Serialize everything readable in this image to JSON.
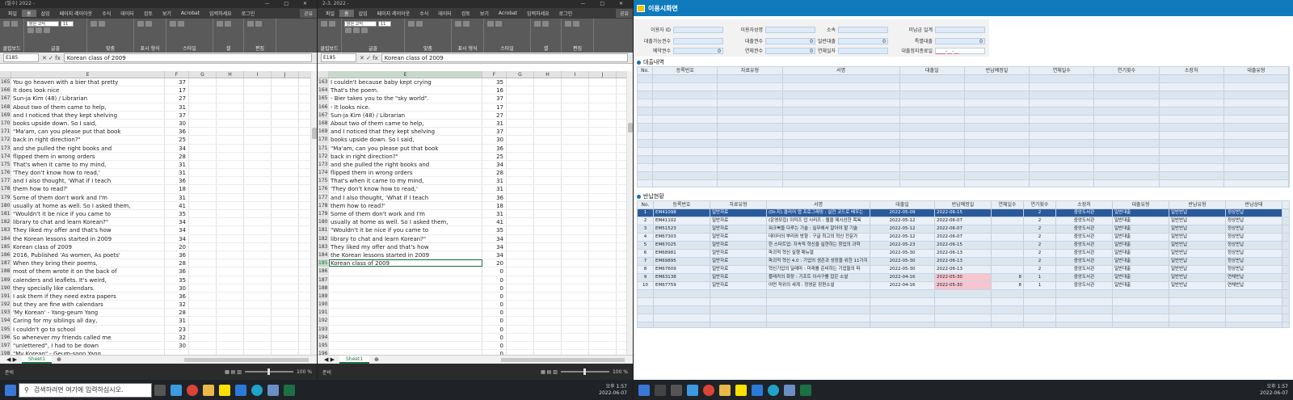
{
  "excel_left": {
    "title": "(필수) 2022 -",
    "ribbon_tabs": [
      "파일",
      "홈",
      "삽입",
      "페이지 레이아웃",
      "수식",
      "데이터",
      "검토",
      "보기",
      "Acrobat",
      "입력하세요",
      "로그인",
      "공유"
    ],
    "ribbon_groups": [
      "클립보드",
      "글꼴",
      "맞춤",
      "표시 형식",
      "스타일",
      "셀",
      "편집"
    ],
    "font_name": "맑은 고딕",
    "font_size": "11",
    "name_box": "E185",
    "formula": "Korean class of 2009",
    "columns": [
      "E",
      "F",
      "G",
      "H",
      "I",
      "J"
    ],
    "rows": [
      {
        "n": "165",
        "e": "You go heaven with a bier that pretty",
        "f": "37"
      },
      {
        "n": "166",
        "e": "It does look nice",
        "f": "17"
      },
      {
        "n": "167",
        "e": "Sun-ja Kim (48) / Librarian",
        "f": "27"
      },
      {
        "n": "168",
        "e": "About two of them came to help,",
        "f": "31"
      },
      {
        "n": "169",
        "e": "and I noticed that they kept shelving",
        "f": "37"
      },
      {
        "n": "170",
        "e": "books upside down.  So I said,",
        "f": "30"
      },
      {
        "n": "171",
        "e": "\"Ma'am, can you please put that book",
        "f": "36"
      },
      {
        "n": "172",
        "e": "back in right direction?\"",
        "f": "25"
      },
      {
        "n": "173",
        "e": "and she pulled the right books and",
        "f": "34"
      },
      {
        "n": "174",
        "e": "flipped them in wrong orders",
        "f": "28"
      },
      {
        "n": "175",
        "e": "That's when it came to my mind,",
        "f": "31"
      },
      {
        "n": "176",
        "e": "'They don't know how to read,'",
        "f": "31"
      },
      {
        "n": "177",
        "e": "and I also thought, 'What if I teach",
        "f": "36"
      },
      {
        "n": "178",
        "e": "them how to read?'",
        "f": "18"
      },
      {
        "n": "179",
        "e": "Some of them don't work and I'm",
        "f": "31"
      },
      {
        "n": "180",
        "e": "usually at home as well. So I asked them,",
        "f": "41"
      },
      {
        "n": "181",
        "e": "\"Wouldn't it be nice if you came to",
        "f": "35"
      },
      {
        "n": "182",
        "e": "library to chat and learn Korean?\"",
        "f": "34"
      },
      {
        "n": "183",
        "e": "They liked my offer and that's how",
        "f": "34"
      },
      {
        "n": "184",
        "e": "the Korean lessons started in 2009",
        "f": "34"
      },
      {
        "n": "185",
        "e": "Korean class of 2009",
        "f": "20"
      },
      {
        "n": "186",
        "e": "2016, Published 'As women, As poets'",
        "f": "36"
      },
      {
        "n": "187",
        "e": "When they bring their poems,",
        "f": "28"
      },
      {
        "n": "188",
        "e": "most of them wrote it on the back of",
        "f": "36"
      },
      {
        "n": "189",
        "e": "calenders and leaflets. It's weird,",
        "f": "35"
      },
      {
        "n": "190",
        "e": "they specially like calendars.",
        "f": "30"
      },
      {
        "n": "191",
        "e": "I ask them if they need extra papers",
        "f": "36"
      },
      {
        "n": "192",
        "e": "but they are fine with calendars",
        "f": "32"
      },
      {
        "n": "193",
        "e": "'My Korean' - Yang-geum Yang",
        "f": "28"
      },
      {
        "n": "194",
        "e": "Caring for my siblings all day,",
        "f": "31"
      },
      {
        "n": "195",
        "e": "I couldn't go to school",
        "f": "23"
      },
      {
        "n": "196",
        "e": "So whenever my friends called me",
        "f": "32"
      },
      {
        "n": "197",
        "e": "\"unlettered\", I had to be down",
        "f": "30"
      },
      {
        "n": "198",
        "e": "\"My Korean\" - Geum-soon Yang",
        "f": ""
      }
    ],
    "sheet_tab": "Sheet1",
    "status_left": "준비",
    "zoom": "100 %"
  },
  "excel_mid": {
    "title": "2-3. 2022 -",
    "name_box": "E185",
    "formula": "Korean class of 2009",
    "columns": [
      "E",
      "F",
      "G",
      "H",
      "I",
      "J"
    ],
    "rows": [
      {
        "n": "163",
        "e": "I couldn't because baby kept crying",
        "f": "35"
      },
      {
        "n": "164",
        "e": "That's the poem.",
        "f": "16"
      },
      {
        "n": "165",
        "e": "- Bier takes you to the \"sky world\".",
        "f": "37"
      },
      {
        "n": "166",
        "e": "- It looks nice.",
        "f": "17"
      },
      {
        "n": "167",
        "e": "Sun-ja Kim (48) / Librarian",
        "f": "27"
      },
      {
        "n": "168",
        "e": "About two of them came to help,",
        "f": "31"
      },
      {
        "n": "169",
        "e": "and I noticed that they kept shelving",
        "f": "37"
      },
      {
        "n": "170",
        "e": "books upside down.  So I said,",
        "f": "30"
      },
      {
        "n": "171",
        "e": "\"Ma'am, can you please put that book",
        "f": "36"
      },
      {
        "n": "172",
        "e": "back in right direction?\"",
        "f": "25"
      },
      {
        "n": "173",
        "e": "and she pulled the right books and",
        "f": "34"
      },
      {
        "n": "174",
        "e": "flipped them in wrong orders",
        "f": "28"
      },
      {
        "n": "175",
        "e": "That's when it came to my mind,",
        "f": "31"
      },
      {
        "n": "176",
        "e": "'They don't know how to read,'",
        "f": "31"
      },
      {
        "n": "177",
        "e": "and I also thought, 'What if I teach",
        "f": "36"
      },
      {
        "n": "178",
        "e": "them how to read?'",
        "f": "18"
      },
      {
        "n": "179",
        "e": "Some of them don't work and I'm",
        "f": "31"
      },
      {
        "n": "180",
        "e": "usually at home as well. So I asked them,",
        "f": "41"
      },
      {
        "n": "181",
        "e": "\"Wouldn't it be nice if you came to",
        "f": "35"
      },
      {
        "n": "182",
        "e": "library to chat and learn Korean?\"",
        "f": "34"
      },
      {
        "n": "183",
        "e": "They liked my offer and that's how",
        "f": "34"
      },
      {
        "n": "184",
        "e": "the Korean lessons started in 2009",
        "f": "34"
      },
      {
        "n": "185",
        "e": "Korean class of 2009",
        "f": "20"
      },
      {
        "n": "186",
        "e": "",
        "f": "0"
      },
      {
        "n": "187",
        "e": "",
        "f": "0"
      },
      {
        "n": "188",
        "e": "",
        "f": "0"
      },
      {
        "n": "189",
        "e": "",
        "f": "0"
      },
      {
        "n": "190",
        "e": "",
        "f": "0"
      },
      {
        "n": "191",
        "e": "",
        "f": "0"
      },
      {
        "n": "192",
        "e": "",
        "f": "0"
      },
      {
        "n": "193",
        "e": "",
        "f": "0"
      },
      {
        "n": "194",
        "e": "",
        "f": "0"
      },
      {
        "n": "195",
        "e": "",
        "f": "0"
      },
      {
        "n": "196",
        "e": "",
        "f": "0"
      },
      {
        "n": "197",
        "e": "",
        "f": "0"
      },
      {
        "n": "198",
        "e": "",
        "f": "0"
      }
    ],
    "sheet_tab": "Sheet1",
    "status_left": "준비",
    "zoom": "100 %"
  },
  "erp": {
    "title": "이용시화면",
    "form": {
      "f1_label": "이용자 ID",
      "f1_value": "",
      "f2_label": "이용자성명",
      "f2_value": "",
      "f3_label": "소속",
      "f3_value": "",
      "f4_label": "미납금 일계",
      "f4_value": "",
      "f5_label": "대출가능권수",
      "f5_value": "",
      "f6_label": "대출권수",
      "f6_value": "0",
      "f7_label": "일반대출",
      "f7_value": "0",
      "f8_label": "특별대출",
      "f8_value": "0",
      "f9_label": "예약권수",
      "f9_value": "0",
      "f10_label": "연체권수",
      "f10_value": "0",
      "f11_label": "연체일자",
      "f11_value": "",
      "f12_label": "대출정지종료일",
      "f12_value": "____-__-__"
    },
    "sec1": "대출내역",
    "t1_headers": [
      "No.",
      "등록번호",
      "자료유형",
      "서명",
      "대출일",
      "반납예정일",
      "연체일수",
      "연기횟수",
      "소장처",
      "대출유형"
    ],
    "sec2": "반납현황",
    "t2_headers": [
      "No.",
      "등록번호",
      "자료유형",
      "서명",
      "대출일",
      "반납예정일",
      "연체일수",
      "연기횟수",
      "소장처",
      "대출유형",
      "반납유형",
      "반납상태"
    ],
    "t2_rows": [
      {
        "no": "1",
        "reg": "EM41098",
        "type": "일반자료",
        "title": "(Dr.지) 클리어 앱 프로그래밍 : 실전 코드로 배우는",
        "loan": "2022-05-09",
        "due": "2022-06-15",
        "over": "",
        "ext": "2",
        "loc": "중앙도서관",
        "ltype": "일반대출",
        "rtype": "일반반납",
        "rstat": "정상반납"
      },
      {
        "no": "2",
        "reg": "EM41102",
        "type": "일반자료",
        "title": "(운영모집) 이미즈 업 시리즈 : 웹을 제시선한 목욕",
        "loan": "2022-05-12",
        "due": "2022-06-07",
        "over": "",
        "ext": "2",
        "loc": "중앙도서관",
        "ltype": "일반대출",
        "rtype": "일반반납",
        "rstat": "정상반납"
      },
      {
        "no": "3",
        "reg": "EM51523",
        "type": "일반자료",
        "title": "워크북을 다루는 기술 : 실무에서 알아야 할 기술",
        "loan": "2022-05-12",
        "due": "2022-06-07",
        "over": "",
        "ext": "2",
        "loc": "중앙도서관",
        "ltype": "일반대출",
        "rtype": "일반반납",
        "rstat": "정상반납"
      },
      {
        "no": "4",
        "reg": "EM67303",
        "type": "일반자료",
        "title": "데이터의 뿌리와 방향 : 구글 최고의 혁신 전문가",
        "loan": "2022-05-12",
        "due": "2022-06-07",
        "over": "",
        "ext": "2",
        "loc": "중앙도서관",
        "ltype": "일반대출",
        "rtype": "일반반납",
        "rstat": "정상반납"
      },
      {
        "no": "5",
        "reg": "EM67025",
        "type": "일반자료",
        "title": "한 스타트업: 지속적 혁신을 실현하는 창업의 과학",
        "loan": "2022-05-23",
        "due": "2022-06-15",
        "over": "",
        "ext": "2",
        "loc": "중앙도서관",
        "ltype": "일반대출",
        "rtype": "일반반납",
        "rstat": "정상반납"
      },
      {
        "no": "6",
        "reg": "EM68981",
        "type": "일반자료",
        "title": "파괴적 혁신 실행 매뉴얼",
        "loan": "2022-05-30",
        "due": "2022-06-13",
        "over": "",
        "ext": "2",
        "loc": "중앙도서관",
        "ltype": "일반대출",
        "rtype": "일반반납",
        "rstat": "정상반납"
      },
      {
        "no": "7",
        "reg": "EM69895",
        "type": "일반자료",
        "title": "파괴적 혁신 4.0 : 기업의 생존과 성장을 위한 11가지",
        "loan": "2022-05-30",
        "due": "2022-06-13",
        "over": "",
        "ext": "2",
        "loc": "중앙도서관",
        "ltype": "일반대출",
        "rtype": "일반반납",
        "rstat": "정상반납"
      },
      {
        "no": "8",
        "reg": "EM67609",
        "type": "일반자료",
        "title": "혁신기업의 딜레마 : 미래를 준비하는 기업들의 파",
        "loan": "2022-05-30",
        "due": "2022-06-13",
        "over": "",
        "ext": "2",
        "loc": "중앙도서관",
        "ltype": "일반대출",
        "rtype": "일반반납",
        "rstat": "정상반납"
      },
      {
        "no": "9",
        "reg": "EM63138",
        "type": "일반자료",
        "title": "플래카의 화장 : 기프트 이사구를 잡은 소설",
        "loan": "2022-04-16",
        "due": "2022-05-30",
        "over": "8",
        "ext": "1",
        "loc": "중앙도서관",
        "ltype": "일반대출",
        "rtype": "일반반납",
        "rstat": "연체반납"
      },
      {
        "no": "10",
        "reg": "EM67759",
        "type": "일반자료",
        "title": "어떤 작위의 세계 : 정영문 장편소설",
        "loan": "2022-04-16",
        "due": "2022-05-30",
        "over": "8",
        "ext": "1",
        "loc": "중앙도서관",
        "ltype": "일반대출",
        "rtype": "일반반납",
        "rstat": "연체반납"
      }
    ]
  },
  "taskbar": {
    "search_placeholder": "검색하려면 여기에 입력하십시오.",
    "time1": "오후 1:57",
    "date1": "2022-06-07",
    "time2": "오후 1:57",
    "date2": "2022-06-07"
  }
}
